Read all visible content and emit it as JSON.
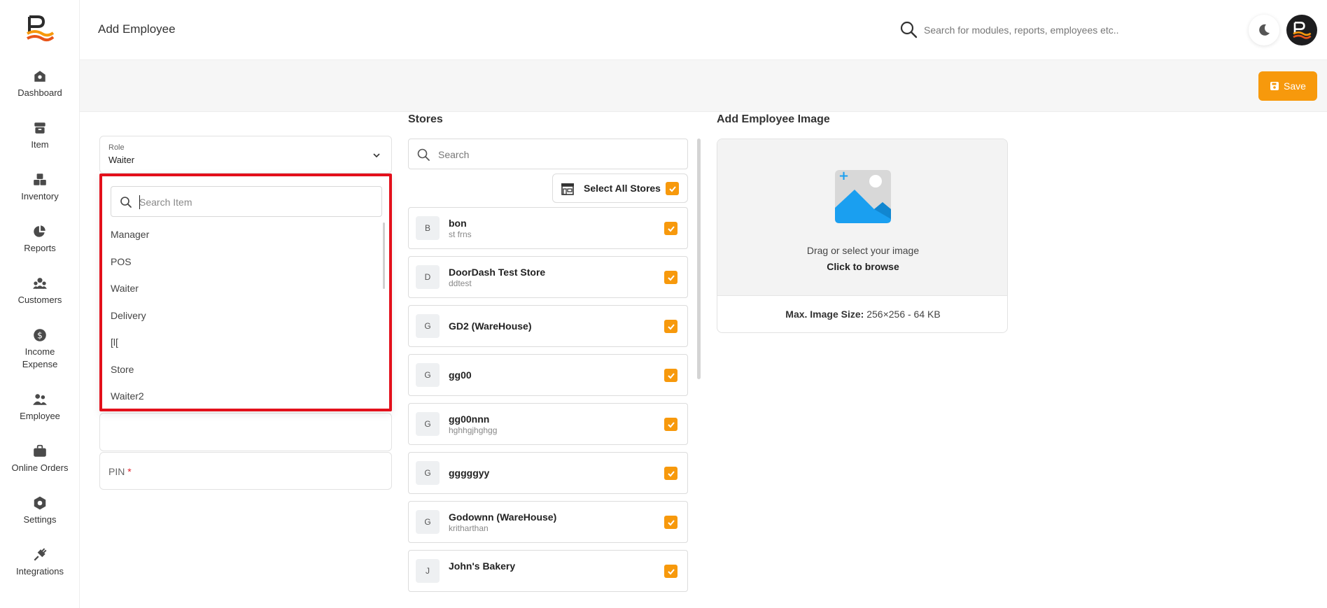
{
  "header": {
    "title": "Add Employee",
    "search_placeholder": "Search for modules, reports, employees etc.."
  },
  "sidebar": {
    "items": [
      {
        "label": "Dashboard",
        "icon": "dashboard-icon"
      },
      {
        "label": "Item",
        "icon": "item-icon"
      },
      {
        "label": "Inventory",
        "icon": "inventory-icon"
      },
      {
        "label": "Reports",
        "icon": "reports-icon"
      },
      {
        "label": "Customers",
        "icon": "customers-icon"
      },
      {
        "label": "Income Expense",
        "icon": "income-expense-icon"
      },
      {
        "label": "Employee",
        "icon": "employee-icon"
      },
      {
        "label": "Online Orders",
        "icon": "online-orders-icon"
      },
      {
        "label": "Settings",
        "icon": "settings-icon"
      },
      {
        "label": "Integrations",
        "icon": "integrations-icon"
      }
    ]
  },
  "toolbar": {
    "save_label": "Save"
  },
  "role": {
    "label": "Role",
    "value": "Waiter",
    "search_placeholder": "Search Item",
    "options": [
      "Manager",
      "POS",
      "Waiter",
      "Delivery",
      "[l[",
      "Store",
      "Waiter2"
    ]
  },
  "pin": {
    "label": "PIN",
    "required": "*"
  },
  "stores": {
    "title": "Stores",
    "search_placeholder": "Search",
    "select_all_label": "Select All Stores",
    "items": [
      {
        "initial": "B",
        "name": "bon",
        "sub": "st frns",
        "checked": true
      },
      {
        "initial": "D",
        "name": "DoorDash Test Store",
        "sub": "ddtest",
        "checked": true
      },
      {
        "initial": "G",
        "name": "GD2 (WareHouse)",
        "sub": "",
        "checked": true
      },
      {
        "initial": "G",
        "name": "gg00",
        "sub": "",
        "checked": true
      },
      {
        "initial": "G",
        "name": "gg00nnn",
        "sub": "hghhgjhghgg",
        "checked": true
      },
      {
        "initial": "G",
        "name": "gggggyy",
        "sub": "",
        "checked": true
      },
      {
        "initial": "G",
        "name": "Godownn (WareHouse)",
        "sub": "kritharthan",
        "checked": true
      },
      {
        "initial": "J",
        "name": "John's Bakery",
        "sub": "",
        "checked": true
      }
    ]
  },
  "image": {
    "title": "Add Employee Image",
    "drag_text": "Drag or select your image",
    "browse_text": "Click to browse",
    "size_label": "Max. Image Size:",
    "size_value": "256×256 - 64 KB"
  },
  "colors": {
    "accent": "#f7990c",
    "highlight": "#e3101b",
    "image_blue": "#1a9ff0"
  }
}
